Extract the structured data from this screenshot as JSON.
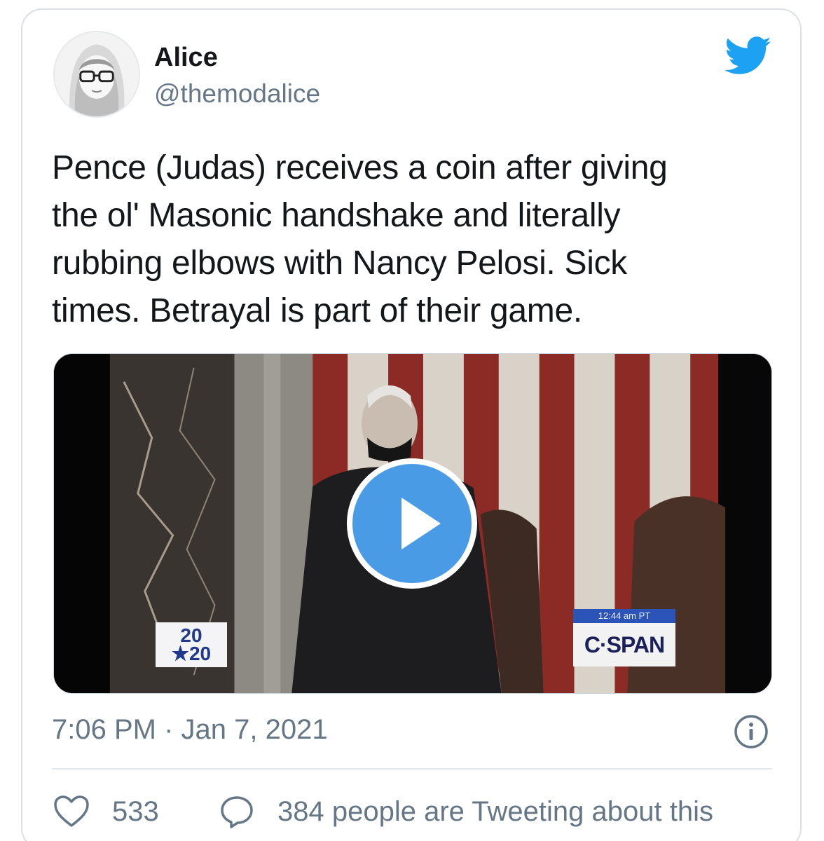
{
  "user": {
    "display_name": "Alice",
    "handle": "@themodalice",
    "avatar_icon": "avatar-sketch"
  },
  "tweet": {
    "text_lines": [
      "Pence (Judas) receives a coin after giving",
      "the ol' Masonic handshake and literally",
      "rubbing elbows with Nancy Pelosi. Sick",
      "times. Betrayal is part of their game."
    ],
    "timestamp": "7:06 PM · Jan 7, 2021"
  },
  "video": {
    "overlay_left_top": "20",
    "overlay_left_bottom": "★20",
    "overlay_right_time": "12:44 am PT",
    "overlay_right_logo": "C·SPAN",
    "play_icon": "play-icon"
  },
  "stats": {
    "likes": "533",
    "people_tweeting": "384 people are Tweeting about this"
  },
  "icons": {
    "brand": "twitter-bird-icon",
    "info": "info-icon",
    "like": "heart-icon",
    "reply": "speech-bubble-icon"
  },
  "colors": {
    "twitter_blue": "#1da1f2",
    "play_blue": "#4a9be6",
    "secondary_text": "#657786",
    "primary_text": "#14171a"
  }
}
